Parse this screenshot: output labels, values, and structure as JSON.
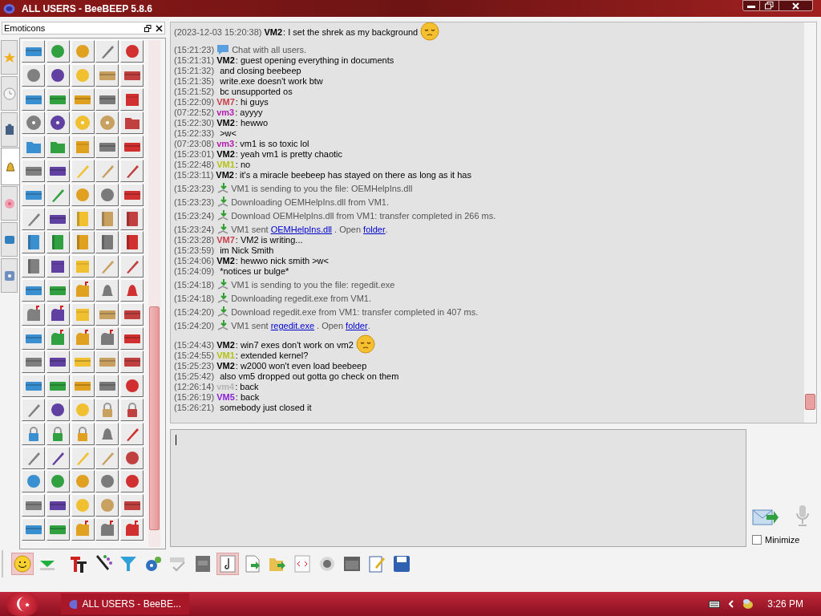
{
  "window": {
    "title": "ALL USERS - BeeBEEP 5.8.6"
  },
  "emoticons_panel": {
    "title": "Emoticons",
    "tabs": [
      {
        "selected": false
      },
      {
        "selected": false
      },
      {
        "selected": false
      },
      {
        "selected": true
      },
      {
        "selected": false
      },
      {
        "selected": false
      },
      {
        "selected": false
      }
    ]
  },
  "chat": {
    "messages": [
      {
        "kind": "message",
        "time": "(2023-12-03 15:20:38)",
        "sender": "VM2",
        "color": "#000000",
        "text": ": I set the shrek as my background",
        "emoji": true
      },
      {
        "kind": "info",
        "time": "(15:21:23)",
        "text": "Chat with all users."
      },
      {
        "kind": "message",
        "time": "(15:21:31)",
        "sender": "VM2",
        "color": "#000000",
        "text": ": guest opening everything in documents"
      },
      {
        "kind": "message",
        "time": "(15:21:32)",
        "text": "and closing beebeep"
      },
      {
        "kind": "message",
        "time": "(15:21:35)",
        "text": "write.exe doesn't work btw"
      },
      {
        "kind": "message",
        "time": "(15:21:52)",
        "text": "bc unsupported os"
      },
      {
        "kind": "message",
        "time": "(15:22:09)",
        "sender": "VM7",
        "color": "#c8404c",
        "text": ": hi guys"
      },
      {
        "kind": "message",
        "time": "(07:22:52)",
        "sender": "vm3",
        "color": "#b01fb0",
        "text": ": ayyyy"
      },
      {
        "kind": "message",
        "time": "(15:22:30)",
        "sender": "VM2",
        "color": "#000000",
        "text": ": hewwo"
      },
      {
        "kind": "message",
        "time": "(15:22:33)",
        "text": ">w<"
      },
      {
        "kind": "message",
        "time": "(07:23:08)",
        "sender": "vm3",
        "color": "#b01fb0",
        "text": ": vm1 is so toxic lol"
      },
      {
        "kind": "message",
        "time": "(15:23:01)",
        "sender": "VM2",
        "color": "#000000",
        "text": ": yeah vm1 is pretty chaotic"
      },
      {
        "kind": "message",
        "time": "(15:22:48)",
        "sender": "VM1",
        "color": "#b4c214",
        "text": ": no"
      },
      {
        "kind": "message",
        "time": "(15:23:11)",
        "sender": "VM2",
        "color": "#000000",
        "text": ": it's a miracle beebeep has stayed on there as long as it has"
      },
      {
        "kind": "file",
        "time": "(15:23:23)",
        "parts": [
          {
            "text": "VM1 is sending to you the file: OEMHelpIns.dll",
            "link": false
          }
        ]
      },
      {
        "kind": "file",
        "time": "(15:23:23)",
        "parts": [
          {
            "text": "Downloading OEMHelpIns.dll from VM1.",
            "link": false
          }
        ]
      },
      {
        "kind": "file",
        "time": "(15:23:24)",
        "parts": [
          {
            "text": "Download OEMHelpIns.dll from VM1: transfer completed in 266 ms.",
            "link": false
          }
        ]
      },
      {
        "kind": "file",
        "time": "(15:23:24)",
        "parts": [
          {
            "text": "VM1 sent",
            "link": false
          },
          {
            "text": "OEMHelpIns.dll",
            "link": true
          },
          {
            "text": ". Open",
            "link": false
          },
          {
            "text": "folder",
            "link": true
          },
          {
            "text": ".",
            "link": false
          }
        ]
      },
      {
        "kind": "message",
        "time": "(15:23:28)",
        "sender": "VM7",
        "color": "#c8404c",
        "text": ": VM2 is writing..."
      },
      {
        "kind": "message",
        "time": "(15:23:59)",
        "text": "im Nick Smith"
      },
      {
        "kind": "message",
        "time": "(15:24:06)",
        "sender": "VM2",
        "color": "#000000",
        "text": ": hewwo nick smith >w<"
      },
      {
        "kind": "message",
        "time": "(15:24:09)",
        "text": "*notices ur bulge*"
      },
      {
        "kind": "file",
        "time": "(15:24:18)",
        "parts": [
          {
            "text": "VM1 is sending to you the file: regedit.exe",
            "link": false
          }
        ]
      },
      {
        "kind": "file",
        "time": "(15:24:18)",
        "parts": [
          {
            "text": "Downloading regedit.exe from VM1.",
            "link": false
          }
        ]
      },
      {
        "kind": "file",
        "time": "(15:24:20)",
        "parts": [
          {
            "text": "Download regedit.exe from VM1: transfer completed in 407 ms.",
            "link": false
          }
        ]
      },
      {
        "kind": "file",
        "time": "(15:24:20)",
        "parts": [
          {
            "text": "VM1 sent",
            "link": false
          },
          {
            "text": "regedit.exe",
            "link": true
          },
          {
            "text": ". Open",
            "link": false
          },
          {
            "text": "folder",
            "link": true
          },
          {
            "text": ".",
            "link": false
          }
        ]
      },
      {
        "kind": "message",
        "time": "(15:24:43)",
        "sender": "VM2",
        "color": "#000000",
        "text": ": win7 exes don't work on vm2",
        "emoji": true
      },
      {
        "kind": "message",
        "time": "(15:24:55)",
        "sender": "VM1",
        "color": "#b4c214",
        "text": ": extended kernel?"
      },
      {
        "kind": "message",
        "time": "(15:25:23)",
        "sender": "VM2",
        "color": "#000000",
        "text": ": w2000 won't even load beebeep"
      },
      {
        "kind": "message",
        "time": "(15:25:42)",
        "text": "also vm5 dropped out gotta go check on them"
      },
      {
        "kind": "message",
        "time": "(12:26:14)",
        "sender": "vm4",
        "color": "#b4b4b4",
        "text": ": back"
      },
      {
        "kind": "message",
        "time": "(15:26:19)",
        "sender": "VM5",
        "color": "#8a22d8",
        "text": ": back"
      },
      {
        "kind": "message",
        "time": "(15:26:21)",
        "text": "somebody just closed it"
      }
    ]
  },
  "minimize": {
    "label": "Minimize",
    "checked": false
  },
  "toolbar": [
    {
      "selected": true
    },
    {
      "selected": false
    },
    {
      "selected": false
    },
    {
      "selected": false
    },
    {
      "selected": false
    },
    {
      "selected": false
    },
    {
      "selected": false
    },
    {
      "selected": false
    },
    {
      "selected": true
    },
    {
      "selected": false
    },
    {
      "selected": false
    },
    {
      "selected": false
    },
    {
      "selected": false
    },
    {
      "selected": false
    },
    {
      "selected": false
    },
    {
      "selected": false
    }
  ],
  "taskbar": {
    "task": "ALL USERS - BeeBE...",
    "clock": "3:26 PM"
  }
}
